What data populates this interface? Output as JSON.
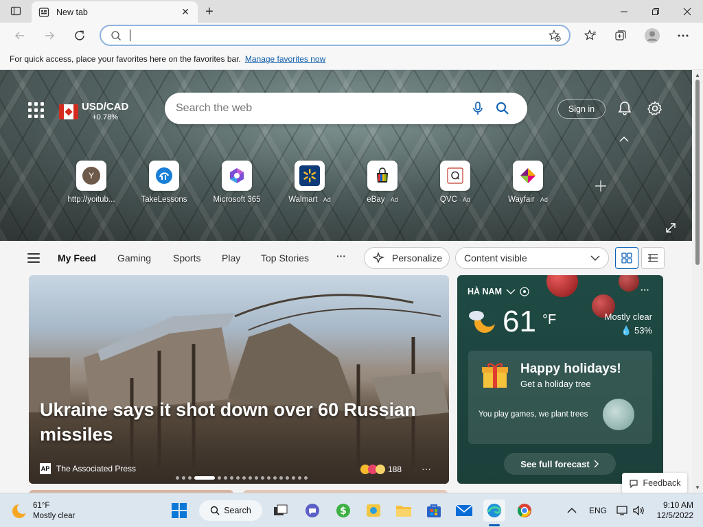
{
  "browser": {
    "tab_title": "New tab",
    "address_value": "",
    "favbar_text": "For quick access, place your favorites here on the favorites bar.",
    "favbar_link": "Manage favorites now"
  },
  "hero": {
    "currency_pair": "USD/CAD",
    "currency_change": "+0.78%",
    "search_placeholder": "Search the web",
    "signin_label": "Sign in",
    "quick_links": [
      {
        "label": "http://yoitub...",
        "ad": "",
        "letter": "Y",
        "icon": "letter-y-icon"
      },
      {
        "label": "TakeLessons",
        "ad": "",
        "icon": "takelessons-icon"
      },
      {
        "label": "Microsoft 365",
        "ad": "",
        "icon": "microsoft365-icon"
      },
      {
        "label": "Walmart",
        "ad": "· Ad",
        "icon": "walmart-icon"
      },
      {
        "label": "eBay",
        "ad": "· Ad",
        "icon": "ebay-icon"
      },
      {
        "label": "QVC",
        "ad": "· Ad",
        "icon": "qvc-icon"
      },
      {
        "label": "Wayfair",
        "ad": "· Ad",
        "icon": "wayfair-icon"
      }
    ]
  },
  "feed_nav": {
    "tabs": [
      "My Feed",
      "Gaming",
      "Sports",
      "Play",
      "Top Stories"
    ],
    "more": "···",
    "personalize_label": "Personalize",
    "content_select": "Content visible"
  },
  "news": {
    "headline": "Ukraine says it shot down over 60 Russian missiles",
    "source": "The Associated Press",
    "source_logo": "AP",
    "reactions": "188",
    "more": "···"
  },
  "weather": {
    "location": "HÀ NAM",
    "temp": "61",
    "unit": "°F",
    "condition": "Mostly clear",
    "humidity": "53%",
    "more": "···",
    "promo_title": "Happy holidays!",
    "promo_sub": "Get a holiday tree",
    "promo_text": "You play games, we plant trees",
    "forecast_label": "See full forecast"
  },
  "feedback_label": "Feedback",
  "taskbar": {
    "weather_temp": "61°F",
    "weather_desc": "Mostly clear",
    "search_label": "Search",
    "lang": "ENG",
    "time": "9:10 AM",
    "date": "12/5/2022"
  },
  "colors": {
    "accent": "#0a5fb5",
    "weather_bg": "#1f4a44",
    "omnibox_border": "#8fb3de"
  }
}
